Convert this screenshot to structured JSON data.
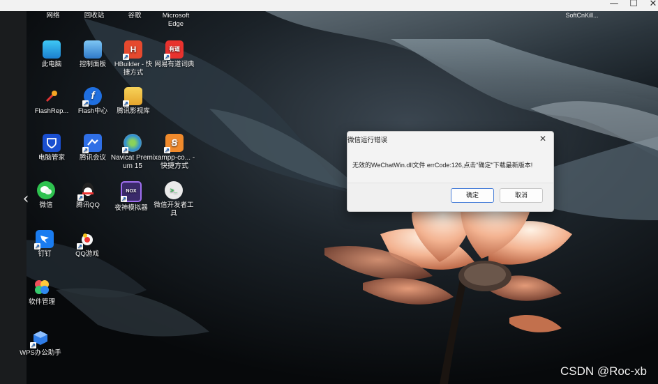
{
  "window": {
    "minimize": "—",
    "maximize": "☐",
    "close": "✕"
  },
  "desktop": {
    "top_row": [
      "网络",
      "回收站",
      "谷歌",
      "Microsoft Edge"
    ],
    "top_right": "SoftCnKill...",
    "nav_back": "‹",
    "icons": [
      {
        "label": "此电脑",
        "icon": "computer-icon"
      },
      {
        "label": "控制面板",
        "icon": "control-panel-icon"
      },
      {
        "label": "HBuilder - 快捷方式",
        "icon": "hbuilder-icon",
        "glyph": "H"
      },
      {
        "label": "网易有道词典",
        "icon": "youdao-icon",
        "glyph": "有道"
      },
      {
        "label": "FlashRep...",
        "icon": "flashrepair-icon"
      },
      {
        "label": "Flash中心",
        "icon": "flash-center-icon",
        "glyph": "f"
      },
      {
        "label": "腾讯影视库",
        "icon": "tencent-video-library-icon"
      },
      {
        "label": "电脑管家",
        "icon": "pc-manager-icon"
      },
      {
        "label": "腾讯会议",
        "icon": "tencent-meeting-icon"
      },
      {
        "label": "Navicat Premium 15",
        "icon": "navicat-icon"
      },
      {
        "label": "xampp-co... - 快捷方式",
        "icon": "xampp-icon",
        "glyph": "ꞩ"
      },
      {
        "label": "微信",
        "icon": "wechat-icon"
      },
      {
        "label": "腾讯QQ",
        "icon": "qq-icon"
      },
      {
        "label": "夜神模拟器",
        "icon": "nox-icon",
        "glyph": "NOX"
      },
      {
        "label": "微信开发者工具",
        "icon": "wechat-devtools-icon",
        "glyph": ">_"
      },
      {
        "label": "钉钉",
        "icon": "dingtalk-icon"
      },
      {
        "label": "QQ游戏",
        "icon": "qq-game-icon"
      },
      {
        "label": "软件管理",
        "icon": "software-manager-icon"
      },
      {
        "label": "WPS办公助手",
        "icon": "wps-assistant-icon"
      }
    ]
  },
  "dialog": {
    "title": "微信运行错误",
    "message": "无效的WeChatWin.dll文件 errCode:126,点击\"确定\"下载最新版本!",
    "ok_label": "确定",
    "cancel_label": "取消",
    "close_glyph": "✕"
  },
  "watermark": "CSDN @Roc-xb"
}
